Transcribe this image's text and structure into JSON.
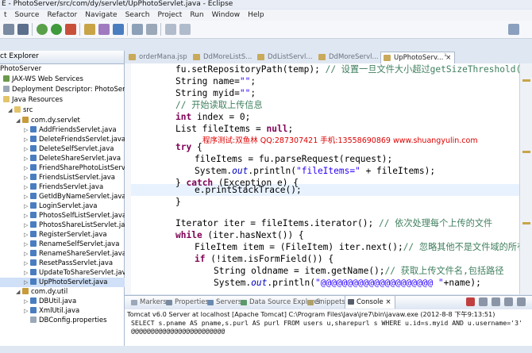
{
  "window": {
    "title": "E - PhotoServer/src/com/dy/servlet/UpPhotoServlet.java - Eclipse"
  },
  "menu": [
    "t",
    "Source",
    "Refactor",
    "Navigate",
    "Search",
    "Project",
    "Run",
    "Window",
    "Help"
  ],
  "explorer": {
    "title": "ct Explorer",
    "items": [
      "PhotoServer",
      "JAX-WS Web Services",
      "Deployment Descriptor: PhotoServe",
      "Java Resources",
      "src",
      "com.dy.servlet",
      "AddFriendsServlet.java",
      "DeleteFriendsServlet.java",
      "DeleteSelfServlet.java",
      "DeleteShareServlet.java",
      "FriendSharePhotoListServ",
      "FriendsListServlet.java",
      "FriendsServlet.java",
      "GetIdByNameServlet.java",
      "LoginServlet.java",
      "PhotosSelfListServlet.java",
      "PhotosShareListServlet.ja",
      "RegisterServlet.java",
      "RenameSelfServlet.java",
      "RenameShareServlet.java",
      "ResetPassServlet.java",
      "UpdateToShareServlet.jav",
      "UpPhotoServlet.java",
      "com.dy.util",
      "DBUtil.java",
      "XmlUtil.java",
      "DBConfig.properties"
    ]
  },
  "tabs": [
    "orderMana.jsp",
    "DdMoreListS...",
    "DdListServl...",
    "DdMoreServl...",
    "UpPhotoServ...",
    "³"
  ],
  "code": {
    "l1": {
      "a": "fu.setRepositoryPath(temp); ",
      "c": "// 设置一旦文件大小超过getSizeThreshold()的值时"
    },
    "l2": {
      "a": "String name=",
      "s": "\"\"",
      "b": ";"
    },
    "l3": {
      "a": "String myid=",
      "s": "\"\"",
      "b": ";"
    },
    "l4": {
      "c": "// 开始读取上传信息"
    },
    "l5": {
      "k": "int",
      "a": " index = 0;"
    },
    "l6": {
      "a": "List fileItems = ",
      "k": "null",
      "b": ";"
    },
    "l7": {
      "k": "try",
      "a": " {"
    },
    "l8": {
      "a": "fileItems = fu.parseRequest(request);"
    },
    "l9": {
      "a": "System.",
      "f": "out",
      "b": ".println(",
      "s": "\"fileItems=\"",
      "d": " + fileItems);"
    },
    "l10": {
      "a": "} ",
      "k": "catch",
      "b": " (Exception e) {"
    },
    "l11": {
      "a": "e.printStackTrace();"
    },
    "l12": {
      "a": "}"
    },
    "l13": {
      "a": "Iterator iter = fileItems.iterator(); ",
      "c": "// 依次处理每个上传的文件"
    },
    "l14": {
      "k": "while",
      "a": " (iter.hasNext()) {"
    },
    "l15": {
      "a": "FileItem item = (FileItem) iter.next();",
      "c": "// 忽略其他不是文件域的所有表单信"
    },
    "l16": {
      "k": "if",
      "a": " (!item.isFormField()) {"
    },
    "l17": {
      "a": "String oldname = item.getName();",
      "c": "// 获取上传文件名,包括路径"
    },
    "l18": {
      "a": "System.",
      "f": "out",
      "b": ".println(",
      "s": "\"@@@@@@@@@@@@@@@@@@@@@ \"",
      "d": "+name);"
    }
  },
  "watermark": "程序测试:双鱼林 QQ:287307421 手机:13558690869 www.shuangyulin.com",
  "bottom_tabs": [
    "Markers",
    "Properties",
    "Servers",
    "Data Source Explorer",
    "Snippets",
    "Console"
  ],
  "console": {
    "header": "Tomcat v6.0 Server at localhost [Apache Tomcat] C:\\Program Files\\Java\\jre7\\bin\\javaw.exe (2012-8-8 下午9:13:51)",
    "line1": "SELECT s.pname AS pname,s.purl AS purl FROM users u,sharepurl s WHERE u.id=s.myid AND u.username='3'",
    "line2": "@@@@@@@@@@@@@@@@@@@@@@@@"
  }
}
